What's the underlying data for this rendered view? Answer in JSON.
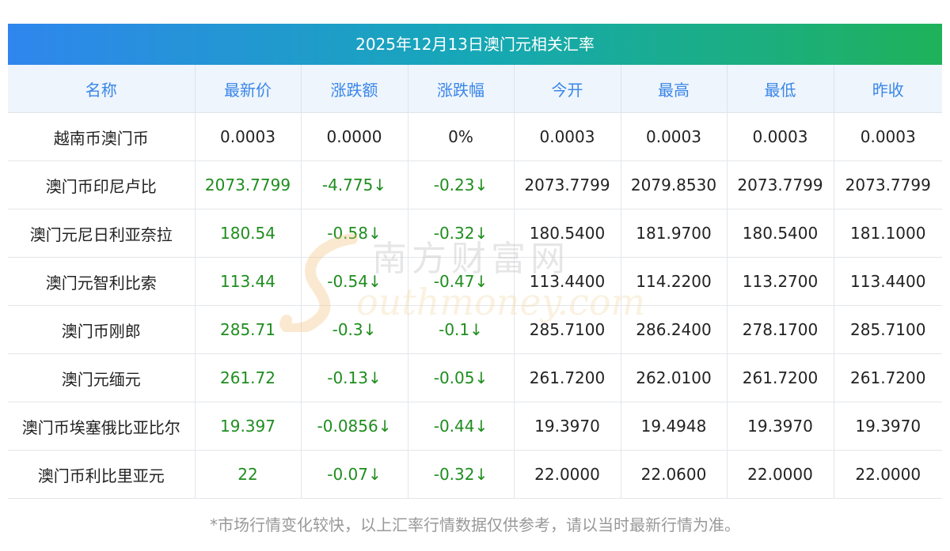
{
  "title": "2025年12月13日澳门元相关汇率",
  "headers": [
    "名称",
    "最新价",
    "涨跌额",
    "涨跌幅",
    "今开",
    "最高",
    "最低",
    "昨收"
  ],
  "rows": [
    {
      "name": "越南币澳门币",
      "latest": "0.0003",
      "change": "0.0000",
      "change_pct": "0%",
      "open": "0.0003",
      "high": "0.0003",
      "low": "0.0003",
      "prev_close": "0.0003"
    },
    {
      "name": "澳门币印尼卢比",
      "latest": "2073.7799",
      "change": "-4.775↓",
      "change_pct": "-0.23↓",
      "open": "2073.7799",
      "high": "2079.8530",
      "low": "2073.7799",
      "prev_close": "2073.7799"
    },
    {
      "name": "澳门元尼日利亚奈拉",
      "latest": "180.54",
      "change": "-0.58↓",
      "change_pct": "-0.32↓",
      "open": "180.5400",
      "high": "181.9700",
      "low": "180.5400",
      "prev_close": "181.1000"
    },
    {
      "name": "澳门元智利比索",
      "latest": "113.44",
      "change": "-0.54↓",
      "change_pct": "-0.47↓",
      "open": "113.4400",
      "high": "114.2200",
      "low": "113.2700",
      "prev_close": "113.4400"
    },
    {
      "name": "澳门币刚郎",
      "latest": "285.71",
      "change": "-0.3↓",
      "change_pct": "-0.1↓",
      "open": "285.7100",
      "high": "286.2400",
      "low": "278.1700",
      "prev_close": "285.7100"
    },
    {
      "name": "澳门元缅元",
      "latest": "261.72",
      "change": "-0.13↓",
      "change_pct": "-0.05↓",
      "open": "261.7200",
      "high": "262.0100",
      "low": "261.7200",
      "prev_close": "261.7200"
    },
    {
      "name": "澳门币埃塞俄比亚比尔",
      "latest": "19.397",
      "change": "-0.0856↓",
      "change_pct": "-0.44↓",
      "open": "19.3970",
      "high": "19.4948",
      "low": "19.3970",
      "prev_close": "19.3970"
    },
    {
      "name": "澳门币利比里亚元",
      "latest": "22",
      "change": "-0.07↓",
      "change_pct": "-0.32↓",
      "open": "22.0000",
      "high": "22.0600",
      "low": "22.0000",
      "prev_close": "22.0000"
    }
  ],
  "watermark": {
    "cn": "南方财富网",
    "en": "outhmoney.com"
  },
  "footnote": "*市场行情变化较快，以上汇率行情数据仅供参考，请以当时最新行情为准。",
  "colors": {
    "header_text": "#3a86e8",
    "header_bg": "#eef5fc",
    "down": "#1f8d1f",
    "title_gradient": [
      "#2f86ee",
      "#16a8b6",
      "#1fb25a"
    ]
  }
}
